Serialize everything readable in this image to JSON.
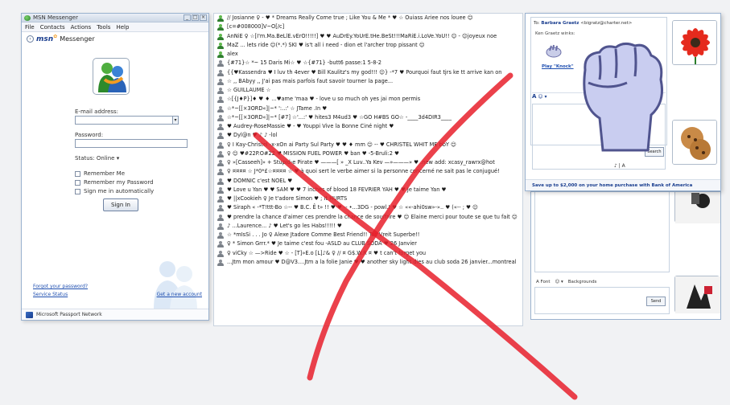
{
  "messenger": {
    "title": "MSN Messenger",
    "menu": [
      "File",
      "Contacts",
      "Actions",
      "Tools",
      "Help"
    ],
    "brand_logo": "msn",
    "brand_name": "Messenger",
    "email_label": "E-mail address:",
    "password_label": "Password:",
    "status_label": "Status: Online",
    "remember_me": "Remember Me",
    "remember_password": "Remember my Password",
    "auto_sign_in": "Sign me in automatically",
    "sign_in": "Sign In",
    "forgot_password": "Forgot your password?",
    "service_status": "Service Status",
    "get_account": "Get a new account",
    "footer": "Microsoft Passport Network"
  },
  "contacts": [
    {
      "text": "// Josianne ♀ - ♥ * Dreams Really Come true ; Like You & Me * ♥ ☆ Ouiass Ariee nos louee 😊",
      "online": true
    },
    {
      "text": "[c=#008000]V~O[/c]",
      "online": true
    },
    {
      "text": "AnNiE ♀ ☆[I'm.Ma.BeLlE.vErO!!!!!] ♥ ♥ AuDrEy.YoUrE.tHe.BeSt!!!MaRiE.i.LoVe.YoU!! 😊 - 😊joyeux noe",
      "online": true
    },
    {
      "text": "MaZ ... lets ride 😊(*.*) SKI ♥          is't all i need - dion et l'archer  trop pissant 😊",
      "online": true
    },
    {
      "text": "alex",
      "online": true
    },
    {
      "text": "{#71}☆ *~ 15 Daris Mi☆ ♥ ☆{#71} -butt6 passe:1 5-8-2",
      "online": false
    },
    {
      "text": "{{♥Kassendra  ♥ I luv th 4ever ♥ Bill Kaulitz's my god!!! 😊} -*7 ♥ Pourquoi faut tjrs ke tt arrive kan on",
      "online": false
    },
    {
      "text": "☆ ,, BAbyy ,,   J'ai pas mais parfois faut savoir tourner la page...",
      "online": false
    },
    {
      "text": "☆ GUILLAUME ☆",
      "online": false
    },
    {
      "text": "☆[{J♦P}]♦ ♥ ♦ ...♥ame 'maa ♥ - love u so much                        oh yes jai mon permis",
      "online": false
    },
    {
      "text": "☆*~[[×3ORD«]|~* ':..:' ☆ JTame .In ♥",
      "online": false
    },
    {
      "text": "☆*~[[×3ORD«]|~* [#7] ☆'...:' ♥ hites3 M4ud3 ♥       ☆GO H#BS GO☆ -____3d4DIR3____",
      "online": false
    },
    {
      "text": "♥ Audrey-RoseMassie ♥ - ♥ Youppi Vive la Bonne Ciné night ♥",
      "online": false
    },
    {
      "text": "♥ Dyl@n ♥ ♪ ♪ -lol",
      "online": false
    },
    {
      "text": "♀ I Kay-Christel  -x-xOn ai Party Sul Party ♥ ♥ ♦ mm 😊 --     ♥ CHRISTEL WHIT ME bbY 😊",
      "online": false
    },
    {
      "text": "♀ 😊 ♥#22P.O#22 ♥ MISSION FUEL POWER ♥ ban ♥ -5-Bruli:2 ♥",
      "online": false
    },
    {
      "text": "♀ »[Casseeh]»  + Stupid-e Pirate ♥ ———[ » _X Luv..Ya Kev —»———» ♥ .new add: xcasy_rawrx@hot",
      "online": false
    },
    {
      "text": "♀ ¤¤¤¤ ☆ J*0*£☆¤¤¤¤ ☆ ♥ à quoi sert le verbe aimer si la personne concerné ne sait pas le conjugué!",
      "online": false
    },
    {
      "text": "♥ DOMNIC c'est NOEL ♥",
      "online": false
    },
    {
      "text": "♥ Love u Yan ♥ ♥ SAM ♥ ♥ 7 inches of blood 18 FEVRIER YAH ♥ ♥  Je taime Yan ♥",
      "online": false
    },
    {
      "text": "♥ ||xCookieh ♀ Je t'adore Simon ♥         ; It HURTS",
      "online": false
    },
    {
      "text": "♥ Siraph  « -*T!ttt-Bo ☆-- ♥ B.C. Ê t» !! ♥ ♥ -- •...3DG - powl.! ♥ ☆ ««-ahi0sw»-».. ♥ («-- ; ♥ 😊",
      "online": false
    },
    {
      "text": "♥ prendre la chance d'aimer ces prendre la chance de souffrire ♥ 😊 Elaine merci pour toute se que tu fait 😊",
      "online": false
    },
    {
      "text": "♪ ...Laurence... ♪ ♥ Let's go les Habs!!!!! ♥",
      "online": false
    },
    {
      "text": "☆ *mIsSi . . . Jo ♀ Alexe Jtadore Comme Best Friend!! Tes Vreit Superbe!!",
      "online": false
    },
    {
      "text": "♀  *      Simon            Grrr.*     ♥ Je taime c'est fou  -ASLD au CLUB SODA ♥    26 Janvier",
      "online": false
    },
    {
      "text": "♀      viCky    ☆    —>Ride ♥ ☆ -  [T]»E.o [L]♪& ♀ // ¤ G$.W.R ¤ ♥ t can't forget you",
      "online": false
    },
    {
      "text": "...Jtm mon amour ♥ D@V3....Jtm a la folie Janie ♥ ♥ another sky light dies au  club soda 26 janvier...montreal",
      "online": false
    }
  ],
  "conversation": {
    "to_label": "To:",
    "to_name": "Barbara Graetz",
    "to_email": "<bigratz@charter.net>",
    "wink_line": "Ken Graetz winks:",
    "play_link": "Play \"Knock\"",
    "send": "Send",
    "ad": "Save up to $2,000 on your home purchase with Bank of America",
    "font_label": "A",
    "toolbar_icons": "♪ | A",
    "search": "Search"
  },
  "conversation2": {
    "font_label": "A Font",
    "backgrounds": "Backgrounds",
    "send": "Send"
  },
  "colors": {
    "red_x": "#e8202b",
    "msn_blue": "#1a3e8f",
    "link_blue": "#1f4fb0"
  }
}
